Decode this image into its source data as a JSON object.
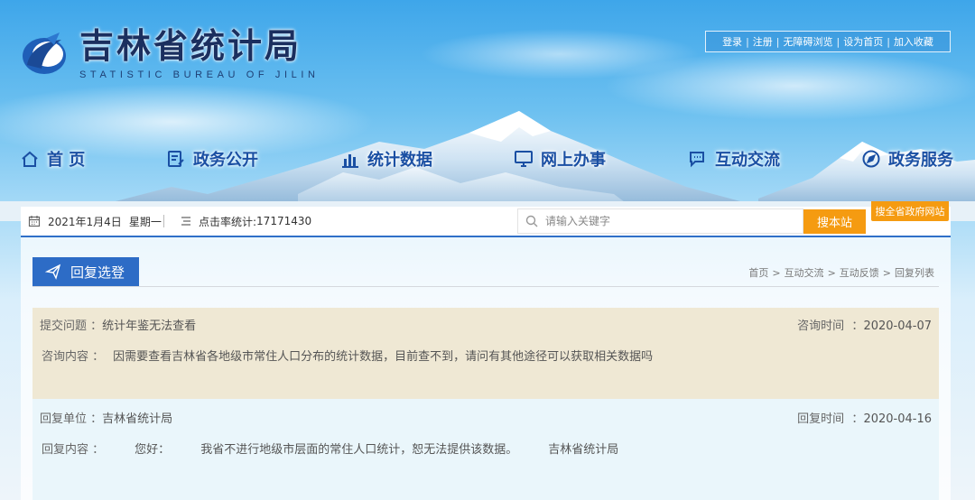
{
  "brand": {
    "title": "吉林省统计局",
    "subtitle": "STATISTIC BUREAU OF JILIN"
  },
  "top_links": [
    "登录",
    "注册",
    "无障碍浏览",
    "设为首页",
    "加入收藏"
  ],
  "nav": [
    {
      "label": "首 页",
      "icon": "home-icon"
    },
    {
      "label": "政务公开",
      "icon": "document-edit-icon"
    },
    {
      "label": "统计数据",
      "icon": "bar-chart-icon"
    },
    {
      "label": "网上办事",
      "icon": "monitor-icon"
    },
    {
      "label": "互动交流",
      "icon": "chat-icon"
    },
    {
      "label": "政务服务",
      "icon": "compass-icon"
    }
  ],
  "info_bar": {
    "date": "2021年1月4日",
    "weekday": "星期一",
    "clicks_label": "点击率统计:",
    "clicks_value": "17171430",
    "search_placeholder": "请输入关键字",
    "search_button": "搜本站",
    "search_gov_button": "搜全省政府网站"
  },
  "section": {
    "title": "回复选登",
    "breadcrumb": [
      "首页",
      "互动交流",
      "互动反馈",
      "回复列表"
    ]
  },
  "question": {
    "subject_label": "提交问题",
    "subject_value": "统计年鉴无法查看",
    "time_label": "咨询时间",
    "time_value": "2020-04-07",
    "content_label": "咨询内容",
    "content_value": "因需要查看吉林省各地级市常住人口分布的统计数据，目前查不到，请问有其他途径可以获取相关数据吗"
  },
  "reply": {
    "unit_label": "回复单位",
    "unit_value": "吉林省统计局",
    "time_label": "回复时间",
    "time_value": "2020-04-16",
    "content_label": "回复内容",
    "greeting": "您好：",
    "content_value": "我省不进行地级市层面的常住人口统计，恕无法提供该数据。",
    "signature": "吉林省统计局"
  },
  "colors": {
    "nav_text": "#1a4fa3",
    "accent_blue": "#2d6cc6",
    "search_orange": "#f59b11",
    "question_bg": "#efe8d4",
    "reply_bg": "#eaf6fb"
  }
}
